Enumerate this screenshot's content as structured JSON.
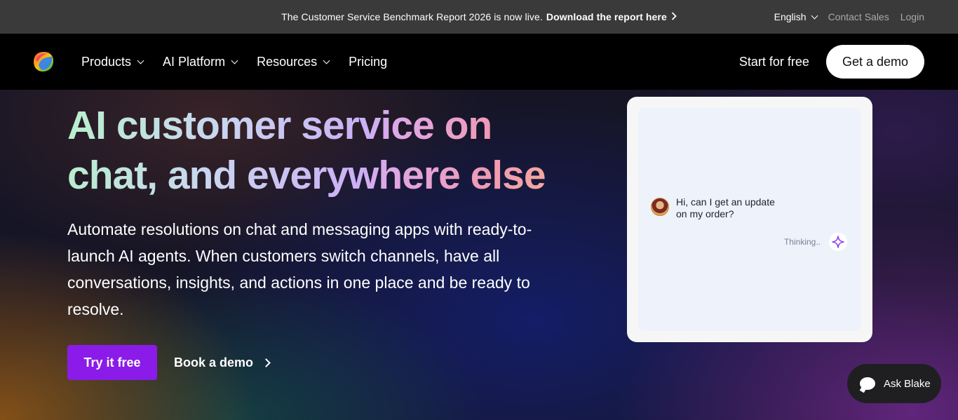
{
  "announcement": {
    "text": "The Customer Service Benchmark Report 2026 is now live.",
    "link": "Download the report here"
  },
  "utility_nav": {
    "language": "English",
    "contact_sales": "Contact Sales",
    "login": "Login"
  },
  "main_nav": {
    "logo_icon": "zendesk-style-logo",
    "items": [
      {
        "label": "Products",
        "has_dropdown": true
      },
      {
        "label": "AI Platform",
        "has_dropdown": true
      },
      {
        "label": "Resources",
        "has_dropdown": true
      },
      {
        "label": "Pricing",
        "has_dropdown": false
      }
    ],
    "start_free": "Start for free",
    "get_demo": "Get a demo"
  },
  "hero": {
    "headline_line1": "AI customer service on",
    "headline_line2": "chat, and everywhere else",
    "subtext": "Automate resolutions on chat and messaging apps with ready-to-launch AI agents. When customers switch channels, have all conversations, insights, and actions in one place and be ready to resolve.",
    "primary_cta": "Try it free",
    "secondary_cta": "Book a demo"
  },
  "chat_preview": {
    "customer_message": "Hi, can I get an update on my order?",
    "status": "Thinking..",
    "ai_icon": "sparkle-icon"
  },
  "chat_widget": {
    "label": "Ask Blake",
    "icon": "chat-bubble-icon"
  },
  "colors": {
    "topbar": "#3a3a3a",
    "nav": "#000000",
    "primary_cta": "#8b1be8",
    "ai_sparkle": "#8a3ff0"
  }
}
